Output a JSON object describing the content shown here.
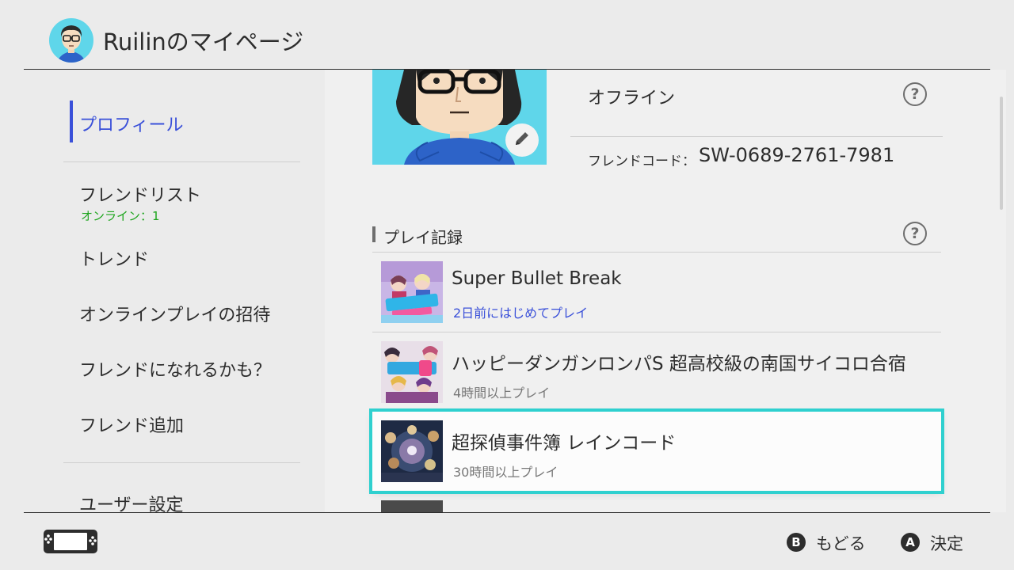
{
  "header": {
    "title": "Ruilinのマイページ"
  },
  "sidebar": {
    "items": [
      {
        "label": "プロフィール"
      },
      {
        "label": "フレンドリスト",
        "sub": "オンライン：1"
      },
      {
        "label": "トレンド"
      },
      {
        "label": "オンラインプレイの招待"
      },
      {
        "label": "フレンドになれるかも？"
      },
      {
        "label": "フレンド追加"
      },
      {
        "label": "ユーザー設定"
      }
    ]
  },
  "profile": {
    "status": "オフライン",
    "friend_code_label": "フレンドコード：",
    "friend_code": "SW-0689-2761-7981"
  },
  "play_history": {
    "title": "プレイ記録",
    "games": [
      {
        "title": "Super Bullet Break",
        "detail": "2日前にはじめてプレイ"
      },
      {
        "title": "ハッピーダンガンロンパS 超高校級の南国サイコロ合宿",
        "detail": "4時間以上プレイ"
      },
      {
        "title": "超探偵事件簿 レインコード",
        "detail": "30時間以上プレイ"
      }
    ]
  },
  "footer": {
    "back_key": "B",
    "back_label": "もどる",
    "ok_key": "A",
    "ok_label": "決定"
  },
  "colors": {
    "accent": "#3a50d9",
    "selection": "#2fd0cf",
    "online": "#1ea51e",
    "mii_bg": "#5fd6ea"
  }
}
